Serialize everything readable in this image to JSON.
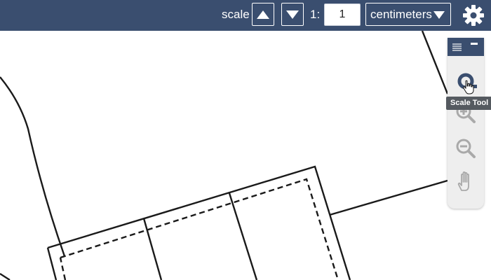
{
  "toolbar": {
    "scale_label": "scale",
    "scale_up_icon": "triangle-up-icon",
    "scale_down_icon": "triangle-down-icon",
    "ratio_prefix": "1:",
    "ratio_value": "1",
    "units_selected": "centimeters",
    "settings_icon": "gear-icon"
  },
  "tool_panel": {
    "header_icon": "menu-icon",
    "minimize_icon": "minimize-icon",
    "tools": [
      {
        "name": "scale-tool",
        "icon": "tape-measure-icon"
      },
      {
        "name": "zoom-in-tool",
        "icon": "zoom-in-icon"
      },
      {
        "name": "zoom-out-tool",
        "icon": "zoom-out-icon"
      },
      {
        "name": "pan-tool",
        "icon": "hand-icon"
      }
    ],
    "tooltip": "Scale Tool"
  },
  "colors": {
    "toolbar_bg": "#3a4e6f",
    "panel_bg": "#eeeeee",
    "tool_icon_active": "#3a4e6f",
    "tool_icon_inactive": "#a9a9a9",
    "tooltip_bg": "#555a60"
  }
}
